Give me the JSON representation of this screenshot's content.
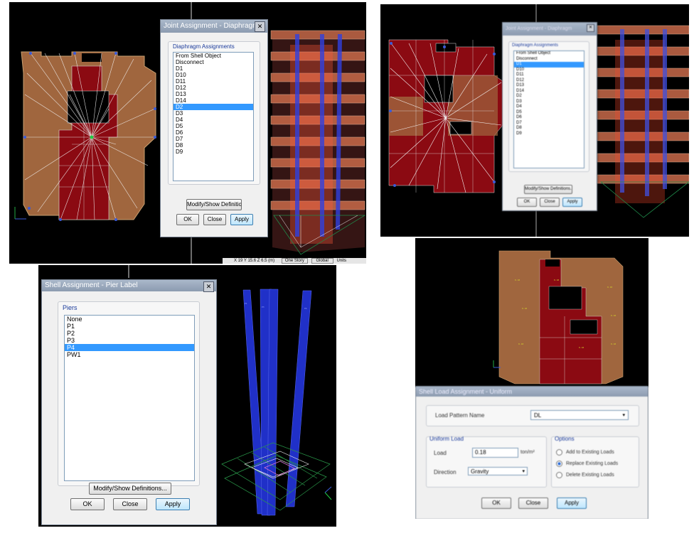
{
  "panel_tl": {
    "dialog": {
      "title": "Joint Assignment - Diaphragm",
      "group_label": "Diaphragm Assignments",
      "items": [
        "From Shell Object",
        "Disconnect",
        "D1",
        "D10",
        "D11",
        "D12",
        "D13",
        "D14",
        "D2",
        "D3",
        "D4",
        "D5",
        "D6",
        "D7",
        "D8",
        "D9"
      ],
      "selected_index": 8,
      "modify_label": "Modify/Show Definitions...",
      "ok_label": "OK",
      "close_label": "Close",
      "apply_label": "Apply"
    },
    "status_coords": "X 19 Y 15.6 Z 6.5 (m)",
    "status_view": "One Story",
    "status_system": "Global",
    "status_units": "Units"
  },
  "panel_tr": {
    "dialog": {
      "title": "Joint Assignment - Diaphragm",
      "group_label": "Diaphragm Assignments",
      "items": [
        "From Shell Object",
        "Disconnect",
        "D1",
        "D10",
        "D11",
        "D12",
        "D13",
        "D14",
        "D2",
        "D3",
        "D4",
        "D5",
        "D6",
        "D7",
        "D8",
        "D9"
      ],
      "selected_index": 2,
      "modify_label": "Modify/Show Definitions...",
      "ok_label": "OK",
      "close_label": "Close",
      "apply_label": "Apply"
    }
  },
  "panel_bl": {
    "dialog": {
      "title": "Shell Assignment - Pier Label",
      "group_label": "Piers",
      "items": [
        "None",
        "P1",
        "P2",
        "P3",
        "P4",
        "PW1"
      ],
      "selected_index": 4,
      "modify_label": "Modify/Show Definitions...",
      "ok_label": "OK",
      "close_label": "Close",
      "apply_label": "Apply"
    }
  },
  "panel_br": {
    "dialog": {
      "title": "Shell Load Assignment - Uniform",
      "load_pattern_label": "Load Pattern Name",
      "load_pattern_value": "DL",
      "uniform_group_label": "Uniform Load",
      "load_label": "Load",
      "load_value": "0.18",
      "load_units": "ton/m²",
      "direction_label": "Direction",
      "direction_value": "Gravity",
      "options_group_label": "Options",
      "options": [
        "Add to Existing Loads",
        "Replace Existing Loads",
        "Delete Existing Loads"
      ],
      "selected_option": 1,
      "ok_label": "OK",
      "close_label": "Close",
      "apply_label": "Apply"
    }
  },
  "colors": {
    "background": "#000000",
    "slab_brown": "#a0663e",
    "slab_red": "#8b0a12",
    "highlight": "#3399ff",
    "pier_blue": "#1f2fc8",
    "grid_green": "#1f8a4a"
  }
}
